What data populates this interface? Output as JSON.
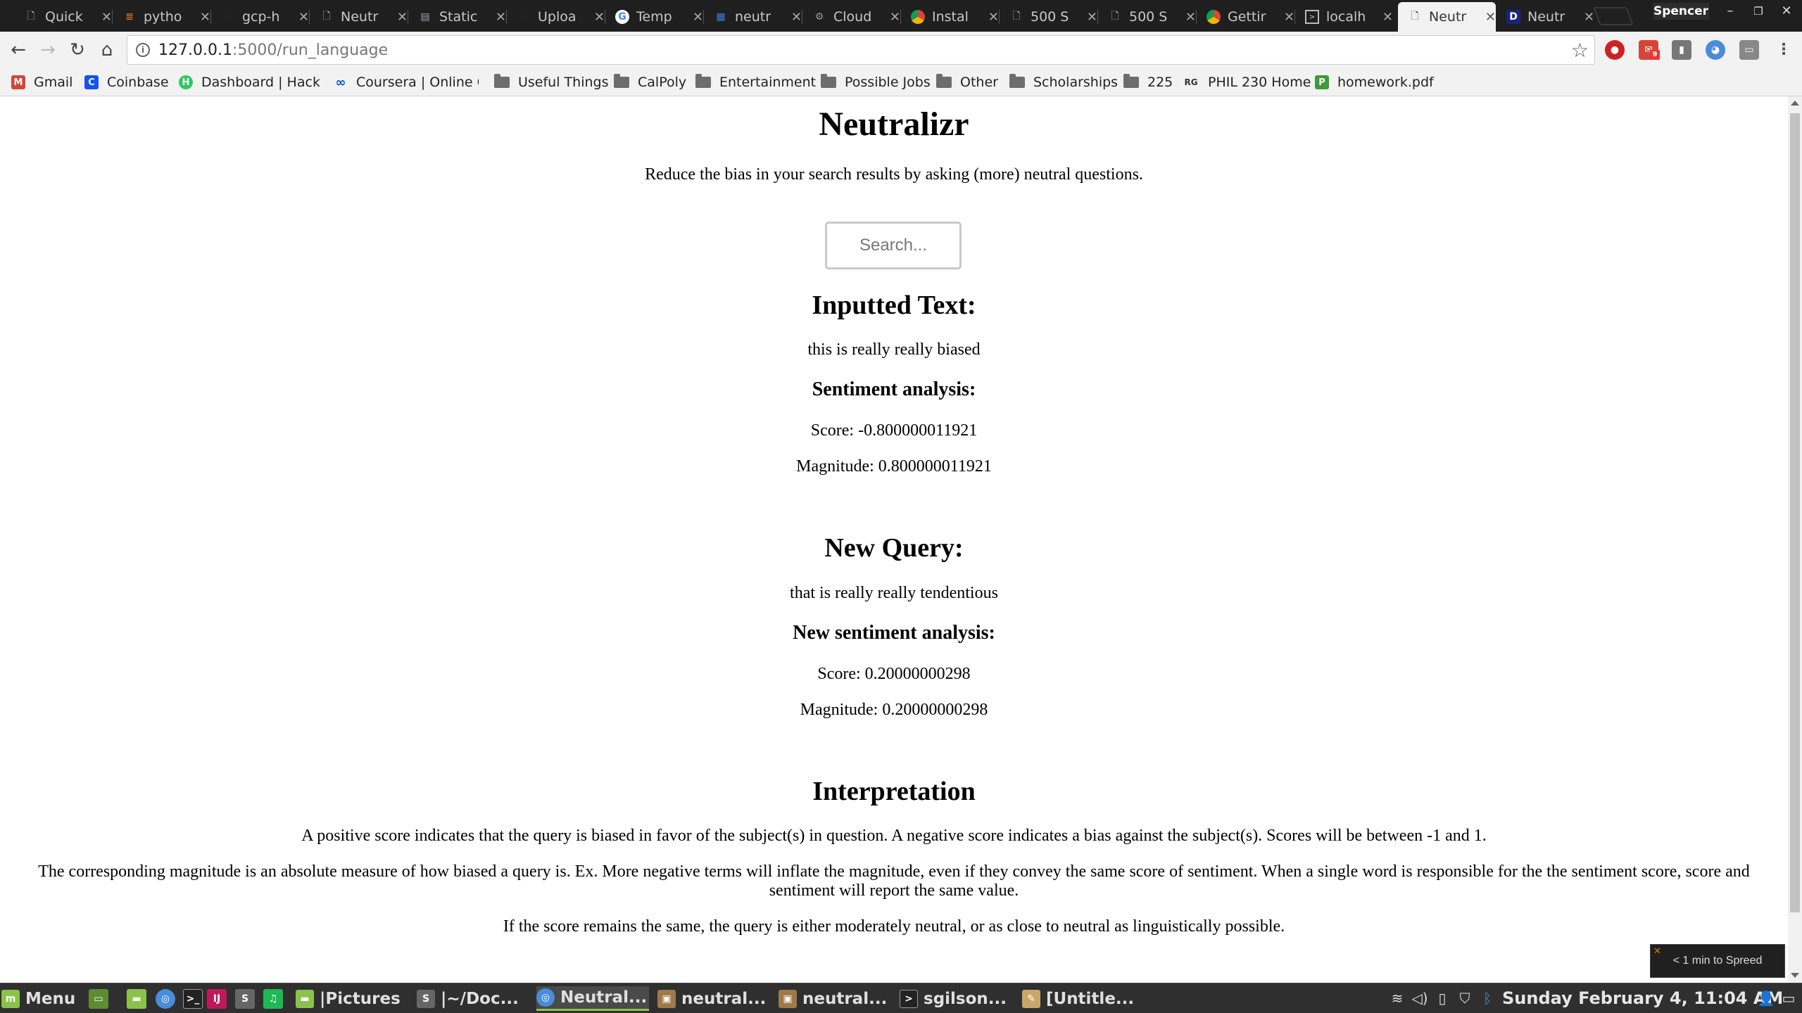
{
  "tabs": [
    {
      "title": "Quick",
      "favicon": "page-icon"
    },
    {
      "title": "pytho",
      "favicon": "stackoverflow-icon"
    },
    {
      "title": "gcp-h",
      "favicon": "github-icon"
    },
    {
      "title": "Neutr",
      "favicon": "page-icon"
    },
    {
      "title": "Static",
      "favicon": "doc-icon"
    },
    {
      "title": "Uploa",
      "favicon": "github-icon"
    },
    {
      "title": "Temp",
      "favicon": "google-icon"
    },
    {
      "title": "neutr",
      "favicon": "table-icon"
    },
    {
      "title": "Cloud",
      "favicon": "cloud-icon"
    },
    {
      "title": "Instal",
      "favicon": "chrome-icon"
    },
    {
      "title": "500 S",
      "favicon": "page-icon"
    },
    {
      "title": "500 S",
      "favicon": "page-icon"
    },
    {
      "title": "Gettir",
      "favicon": "chrome-icon"
    },
    {
      "title": "localh",
      "favicon": "terminal-icon"
    },
    {
      "title": "Neutr",
      "favicon": "page-icon"
    },
    {
      "title": "Neutr",
      "favicon": "d-icon"
    }
  ],
  "window": {
    "profile_name": "Spencer",
    "minimize": "–",
    "restore": "❐",
    "close": "✕"
  },
  "toolbar": {
    "back": "←",
    "forward": "→",
    "reload": "↻",
    "home": "⌂",
    "url_host": "127.0.0.1",
    "url_path": ":5000/run_language",
    "info": "i",
    "star": "☆",
    "mail_badge": "9"
  },
  "bookmarks": [
    {
      "label": "Gmail",
      "icon": "gmail-icon",
      "color": "#d44638",
      "glyph": "M"
    },
    {
      "label": "Coinbase",
      "icon": "coinbase-icon",
      "color": "#1652f0",
      "glyph": "C"
    },
    {
      "label": "Dashboard | Hacke",
      "icon": "hackerrank-icon",
      "color": "#2ec866",
      "glyph": "H"
    },
    {
      "label": "Coursera | Online C",
      "icon": "coursera-icon",
      "color": "#0056d2",
      "glyph": "∞"
    },
    {
      "label": "Useful Things",
      "icon": "folder-icon"
    },
    {
      "label": "CalPoly",
      "icon": "folder-icon"
    },
    {
      "label": "Entertainment",
      "icon": "folder-icon"
    },
    {
      "label": "Possible Jobs",
      "icon": "folder-icon"
    },
    {
      "label": "Other",
      "icon": "folder-icon"
    },
    {
      "label": "Scholarships",
      "icon": "folder-icon"
    },
    {
      "label": "225",
      "icon": "folder-icon"
    },
    {
      "label": "PHIL 230 Home",
      "icon": "rg-icon",
      "color": "#333333",
      "glyph": "RG"
    },
    {
      "label": "homework.pdf",
      "icon": "pdf-icon",
      "color": "#3d9a3d",
      "glyph": "P"
    }
  ],
  "page": {
    "title": "Neutralizr",
    "subtitle": "Reduce the bias in your search results by asking (more) neutral questions.",
    "search_placeholder": "Search...",
    "inputted_heading": "Inputted Text:",
    "inputted_text": "this is really really biased",
    "sentiment_heading": "Sentiment analysis:",
    "score": "Score: -0.800000011921",
    "magnitude": "Magnitude: 0.800000011921",
    "new_query_heading": "New Query:",
    "new_query_text": "that is really really tendentious",
    "new_sentiment_heading": "New sentiment analysis:",
    "new_score": "Score: 0.20000000298",
    "new_magnitude": "Magnitude: 0.20000000298",
    "interpretation_heading": "Interpretation",
    "interp_1": "A positive score indicates that the query is biased in favor of the subject(s) in question. A negative score indicates a bias against the subject(s). Scores will be between -1 and 1.",
    "interp_2": "The corresponding magnitude is an absolute measure of how biased a query is. Ex. More negative terms will inflate the magnitude, even if they convey the same score of sentiment. When a single word is responsible for the the sentiment score, score and sentiment will report the same value.",
    "interp_3": "If the score remains the same, the query is either moderately neutral, or as close to neutral as linguistically possible."
  },
  "toast": {
    "text": "< 1 min to Spreed",
    "close": "✕"
  },
  "taskbar": {
    "menu_label": "Menu",
    "items": [
      {
        "label": "|Pictures",
        "icon": "folder-icon"
      },
      {
        "label": "|~/Doc...",
        "icon": "sublime-icon"
      },
      {
        "label": "Neutral...",
        "icon": "chrome-icon"
      },
      {
        "label": "neutral...",
        "icon": "archive-icon"
      },
      {
        "label": "neutral...",
        "icon": "archive-icon"
      },
      {
        "label": "sgilson...",
        "icon": "terminal-icon"
      },
      {
        "label": "[Untitle...",
        "icon": "editor-icon"
      }
    ],
    "clock": "Sunday February  4, 11:04 AM"
  }
}
